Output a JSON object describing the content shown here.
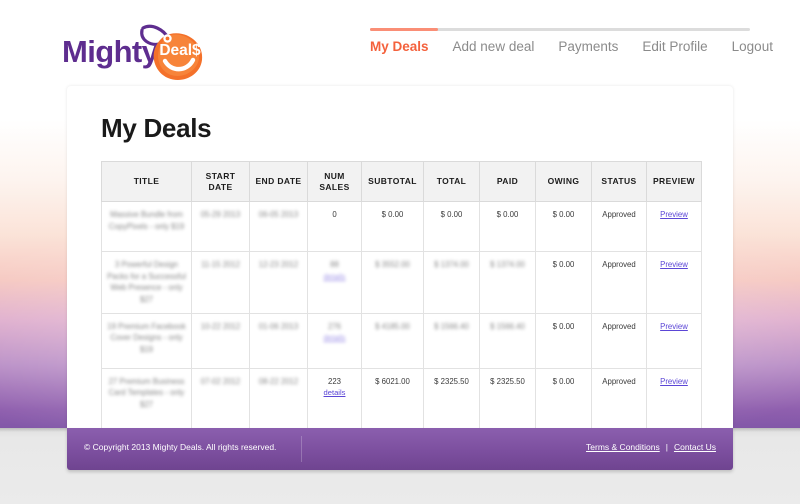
{
  "site": {
    "logo_word": "Mighty",
    "logo_tag_text": "Deal$"
  },
  "nav": {
    "items": [
      {
        "label": "My Deals",
        "active": true
      },
      {
        "label": "Add new deal",
        "active": false
      },
      {
        "label": "Payments",
        "active": false
      },
      {
        "label": "Edit Profile",
        "active": false
      },
      {
        "label": "Logout",
        "active": false
      }
    ]
  },
  "main": {
    "page_title": "My Deals",
    "table": {
      "columns": [
        "TITLE",
        "START DATE",
        "END DATE",
        "NUM SALES",
        "SUBTOTAL",
        "TOTAL",
        "PAID",
        "OWING",
        "STATUS",
        "PREVIEW"
      ],
      "rows": [
        {
          "title": "Massive Bundle from CopyPixels - only $19",
          "title_blurred": true,
          "start_date": "05-29 2013",
          "start_date_blurred": true,
          "end_date": "06-05 2013",
          "end_date_blurred": true,
          "num_sales": "0",
          "num_sales_blurred": false,
          "details_label": "",
          "subtotal": "$ 0.00",
          "subtotal_blurred": false,
          "total": "$ 0.00",
          "total_blurred": false,
          "paid": "$ 0.00",
          "paid_blurred": false,
          "owing": "$ 0.00",
          "status": "Approved",
          "preview_label": "Preview"
        },
        {
          "title": "3 Powerful Design Packs for a Successful Web Presence - only $27",
          "title_blurred": true,
          "start_date": "11-15 2012",
          "start_date_blurred": true,
          "end_date": "12-23 2012",
          "end_date_blurred": true,
          "num_sales": "88",
          "num_sales_blurred": true,
          "details_label": "details",
          "details_blurred": true,
          "subtotal": "$ 3552.00",
          "subtotal_blurred": true,
          "total": "$ 1374.00",
          "total_blurred": true,
          "paid": "$ 1374.00",
          "paid_blurred": true,
          "owing": "$ 0.00",
          "status": "Approved",
          "preview_label": "Preview"
        },
        {
          "title": "19 Premium Facebook Cover Designs - only $19",
          "title_blurred": true,
          "start_date": "10-22 2012",
          "start_date_blurred": true,
          "end_date": "01-06 2013",
          "end_date_blurred": true,
          "num_sales": "276",
          "num_sales_blurred": true,
          "details_label": "details",
          "details_blurred": true,
          "subtotal": "$ 4185.00",
          "subtotal_blurred": true,
          "total": "$ 1566.40",
          "total_blurred": true,
          "paid": "$ 1566.40",
          "paid_blurred": true,
          "owing": "$ 0.00",
          "status": "Approved",
          "preview_label": "Preview"
        },
        {
          "title": "27 Premium Business Card Templates - only $27",
          "title_blurred": true,
          "start_date": "07-02 2012",
          "start_date_blurred": true,
          "end_date": "08-22 2012",
          "end_date_blurred": true,
          "num_sales": "223",
          "num_sales_blurred": false,
          "details_label": "details",
          "details_blurred": false,
          "subtotal": "$ 6021.00",
          "subtotal_blurred": false,
          "total": "$ 2325.50",
          "total_blurred": false,
          "paid": "$ 2325.50",
          "paid_blurred": false,
          "owing": "$ 0.00",
          "status": "Approved",
          "preview_label": "Preview"
        }
      ]
    }
  },
  "footer": {
    "copyright": "© Copyright 2013 Mighty Deals. All rights reserved.",
    "terms_label": "Terms & Conditions",
    "separator": "|",
    "contact_label": "Contact Us"
  },
  "colors": {
    "accent_orange": "#f4613c",
    "logo_purple": "#5e2d8f",
    "tag_orange": "#f4712a",
    "footer_purple": "#7c4f9f",
    "link_purple": "#5b46d6"
  }
}
